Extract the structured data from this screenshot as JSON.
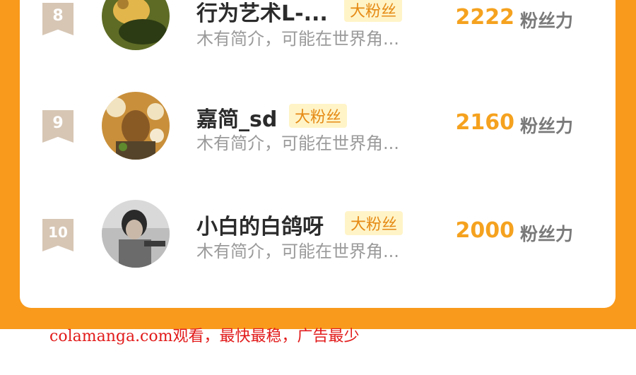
{
  "ranking": {
    "rows": [
      {
        "rank": "8",
        "name": "行为艺术L-...",
        "badge": "大粉丝",
        "intro": "木有简介，可能在世界角...",
        "score": "2222",
        "unit": "粉丝力",
        "avatar_colors": [
          "#6d7a2a",
          "#e3b64b",
          "#2d3b14"
        ]
      },
      {
        "rank": "9",
        "name": "嘉简_sd",
        "badge": "大粉丝",
        "intro": "木有简介，可能在世界角...",
        "score": "2160",
        "unit": "粉丝力",
        "avatar_colors": [
          "#f2e3c0",
          "#c98f3a",
          "#55442a"
        ]
      },
      {
        "rank": "10",
        "name": "小白的白鸽呀",
        "badge": "大粉丝",
        "intro": "木有简介，可能在世界角...",
        "score": "2000",
        "unit": "粉丝力",
        "avatar_colors": [
          "#d9d9d9",
          "#6b6b6b",
          "#2a2a2a"
        ]
      }
    ]
  },
  "footer": {
    "watermark": "colamanga.com观看，最快最稳，广告最少"
  },
  "colors": {
    "accent": "#f99a1c",
    "score": "#f5a21f",
    "badge_bg": "#fff4c8",
    "watermark": "#e21b1b"
  }
}
